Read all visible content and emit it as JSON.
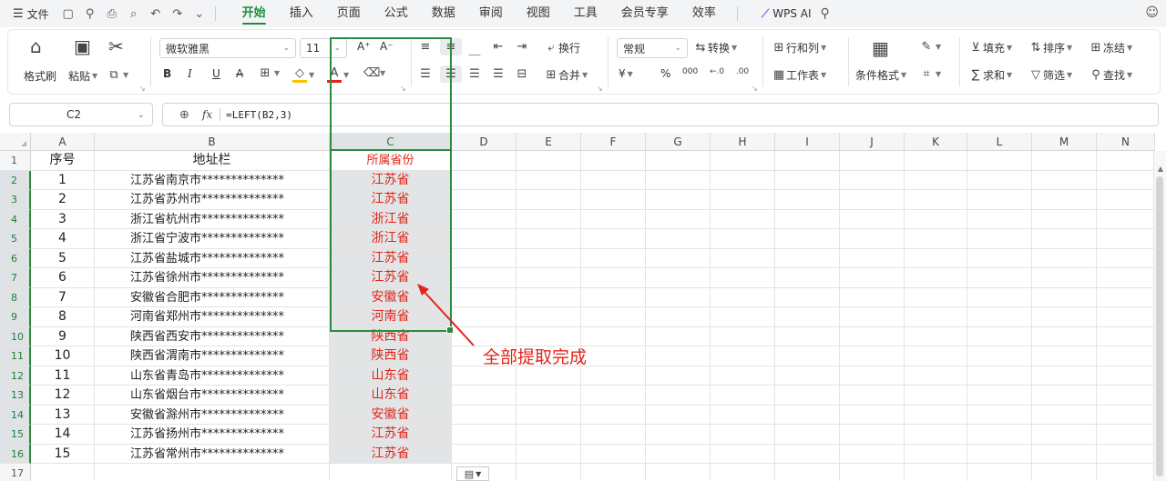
{
  "menubar": {
    "file_label": "文件",
    "tabs": [
      "开始",
      "插入",
      "页面",
      "公式",
      "数据",
      "审阅",
      "视图",
      "工具",
      "会员专享",
      "效率"
    ],
    "active_tab": "开始",
    "wps_ai": "WPS AI"
  },
  "ribbon": {
    "format_painter": "格式刷",
    "paste": "粘贴",
    "font_name": "微软雅黑",
    "font_size": "11",
    "wrap": "换行",
    "merge": "合并",
    "number_format": "常规",
    "convert": "转换",
    "row_col": "行和列",
    "worksheet": "工作表",
    "cond_format": "条件格式",
    "fill": "填充",
    "sort": "排序",
    "freeze": "冻结",
    "sum": "求和",
    "filter": "筛选",
    "find": "查找",
    "bold": "B",
    "italic": "I",
    "underline": "U",
    "strike": "A",
    "font_color_a": "A",
    "grow": "A⁺",
    "shrink": "A⁻",
    "percent": "%",
    "thousand": "000",
    "yen": "¥"
  },
  "formula_bar": {
    "cell_ref": "C2",
    "fx": "fx",
    "formula": "=LEFT(B2,3)"
  },
  "sheet": {
    "columns": [
      "A",
      "B",
      "C",
      "D",
      "E",
      "F",
      "G",
      "H",
      "I",
      "J",
      "K",
      "L",
      "M",
      "N"
    ],
    "selected_column": "C",
    "header_row": {
      "row": "1",
      "a": "序号",
      "b": "地址栏",
      "c": "所属省份"
    },
    "rows": [
      {
        "row": "2",
        "a": "1",
        "b": "江苏省南京市**************",
        "c": "江苏省"
      },
      {
        "row": "3",
        "a": "2",
        "b": "江苏省苏州市**************",
        "c": "江苏省"
      },
      {
        "row": "4",
        "a": "3",
        "b": "浙江省杭州市**************",
        "c": "浙江省"
      },
      {
        "row": "5",
        "a": "4",
        "b": "浙江省宁波市**************",
        "c": "浙江省"
      },
      {
        "row": "6",
        "a": "5",
        "b": "江苏省盐城市**************",
        "c": "江苏省"
      },
      {
        "row": "7",
        "a": "6",
        "b": "江苏省徐州市**************",
        "c": "江苏省"
      },
      {
        "row": "8",
        "a": "7",
        "b": "安徽省合肥市**************",
        "c": "安徽省"
      },
      {
        "row": "9",
        "a": "8",
        "b": "河南省郑州市**************",
        "c": "河南省"
      },
      {
        "row": "10",
        "a": "9",
        "b": "陕西省西安市**************",
        "c": "陕西省"
      },
      {
        "row": "11",
        "a": "10",
        "b": "陕西省渭南市**************",
        "c": "陕西省"
      },
      {
        "row": "12",
        "a": "11",
        "b": "山东省青岛市**************",
        "c": "山东省"
      },
      {
        "row": "13",
        "a": "12",
        "b": "山东省烟台市**************",
        "c": "山东省"
      },
      {
        "row": "14",
        "a": "13",
        "b": "安徽省滁州市**************",
        "c": "安徽省"
      },
      {
        "row": "15",
        "a": "14",
        "b": "江苏省扬州市**************",
        "c": "江苏省"
      },
      {
        "row": "16",
        "a": "15",
        "b": "江苏省常州市**************",
        "c": "江苏省"
      }
    ],
    "last_row": "17"
  },
  "annotation": {
    "text": "全部提取完成",
    "color": "#e0261b"
  },
  "colors": {
    "accent_green": "#2e8b3d",
    "text_red": "#e0261b"
  }
}
